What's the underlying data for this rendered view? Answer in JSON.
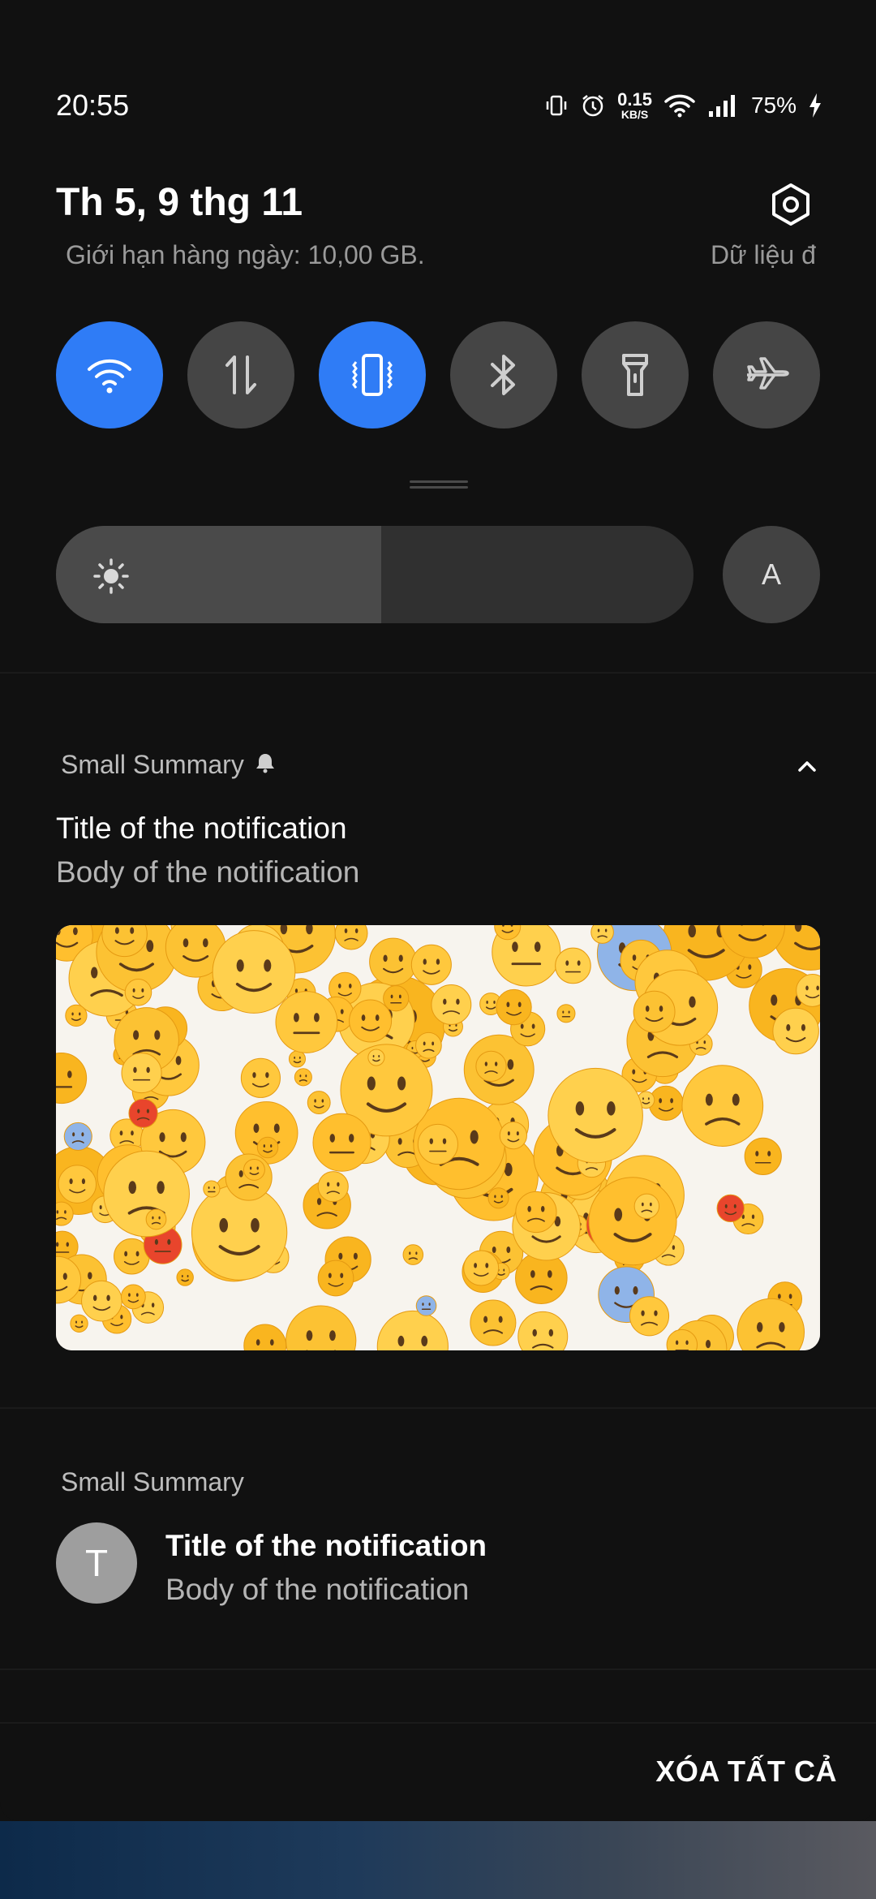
{
  "status_bar": {
    "time": "20:55",
    "net_speed_value": "0.15",
    "net_speed_unit": "KB/S",
    "battery_percent": "75%",
    "icons": [
      "vibrate-icon",
      "alarm-icon",
      "wifi-icon",
      "signal-icon",
      "charging-icon"
    ]
  },
  "header": {
    "date": "Th 5, 9 thg 11",
    "data_limit_text": "Giới hạn hàng ngày: 10,00 GB.",
    "data_used_text": "Dữ liệu đ"
  },
  "quick_toggles": [
    {
      "name": "wifi",
      "icon": "wifi-icon",
      "active": true
    },
    {
      "name": "mobile-data",
      "icon": "mobile-data-icon",
      "active": false
    },
    {
      "name": "vibrate",
      "icon": "vibrate-icon",
      "active": true
    },
    {
      "name": "bluetooth",
      "icon": "bluetooth-icon",
      "active": false
    },
    {
      "name": "flashlight",
      "icon": "flashlight-icon",
      "active": false
    },
    {
      "name": "airplane-mode",
      "icon": "airplane-icon",
      "active": false
    }
  ],
  "brightness": {
    "level": 0.51,
    "auto_label": "A"
  },
  "notifications": [
    {
      "app": "Small Summary",
      "title": "Title of the notification",
      "body": "Body of the notification",
      "image": "emoji-collage",
      "expanded": true
    },
    {
      "app": "Small Summary",
      "avatar_letter": "T",
      "title": "Title of the notification",
      "body": "Body of the notification"
    }
  ],
  "footer": {
    "clear_all_label": "XÓA TẤT CẢ"
  },
  "colors": {
    "accent": "#2f7cf6",
    "panel_bg": "#111111",
    "toggle_off": "#454545"
  }
}
